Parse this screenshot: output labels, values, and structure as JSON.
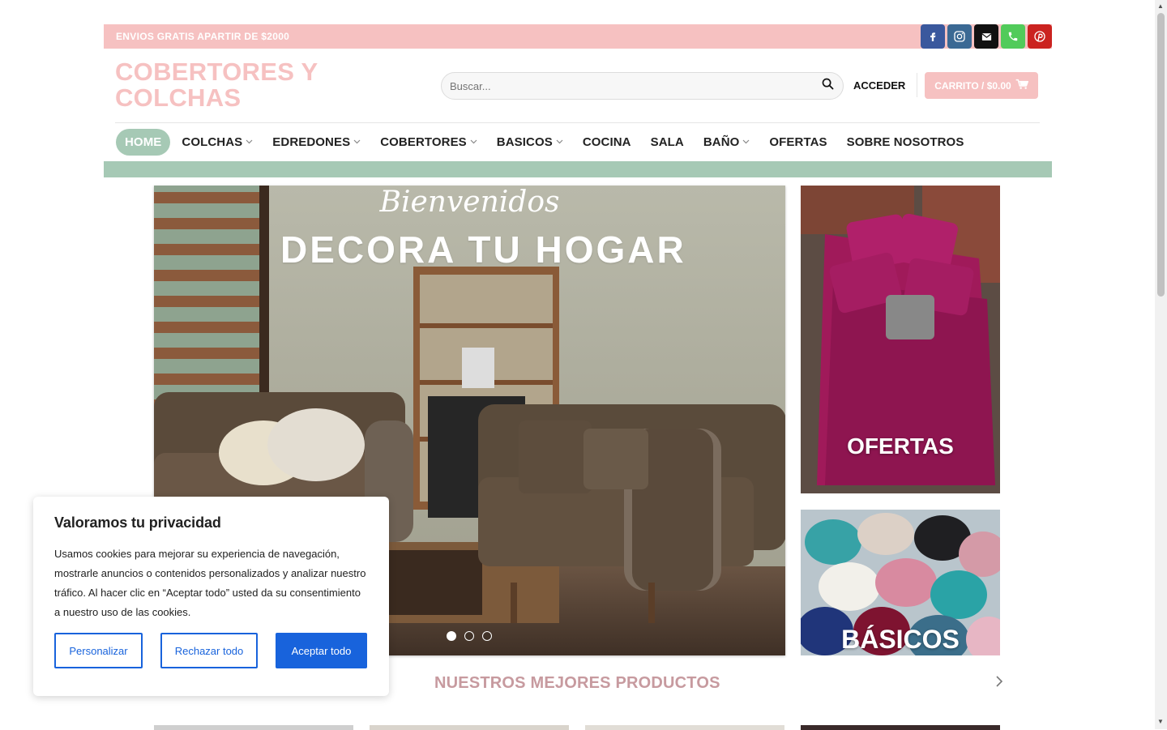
{
  "topbar": {
    "promo": "ENVIOS GRATIS APARTIR DE $2000",
    "social": [
      {
        "name": "facebook-icon",
        "color": "#3a589d"
      },
      {
        "name": "instagram-icon",
        "color": "#3b6994"
      },
      {
        "name": "email-icon",
        "color": "#111111"
      },
      {
        "name": "phone-icon",
        "color": "#51cb5a"
      },
      {
        "name": "pinterest-icon",
        "color": "#cb2320"
      }
    ]
  },
  "header": {
    "logo_line1": "COBERTORES Y",
    "logo_line2": "COLCHAS",
    "search_placeholder": "Buscar...",
    "login": "ACCEDER",
    "cart": "CARRITO / $0.00"
  },
  "nav": {
    "items": [
      {
        "label": "HOME",
        "dropdown": false
      },
      {
        "label": "COLCHAS",
        "dropdown": true
      },
      {
        "label": "EDREDONES",
        "dropdown": true
      },
      {
        "label": "COBERTORES",
        "dropdown": true
      },
      {
        "label": "BASICOS",
        "dropdown": true
      },
      {
        "label": "COCINA",
        "dropdown": false
      },
      {
        "label": "SALA",
        "dropdown": false
      },
      {
        "label": "BAÑO",
        "dropdown": true
      },
      {
        "label": "OFERTAS",
        "dropdown": false
      },
      {
        "label": "SOBRE NOSOTROS",
        "dropdown": false
      }
    ]
  },
  "hero": {
    "welcome": "Bienvenidos",
    "headline": "DECORA TU HOGAR",
    "slides_count": 3,
    "active_slide": 1
  },
  "banners": {
    "ofertas": "OFERTAS",
    "basicos": "BÁSICOS"
  },
  "section": {
    "title": "NUESTROS MEJORES PRODUCTOS"
  },
  "cookie": {
    "title": "Valoramos tu privacidad",
    "body": "Usamos cookies para mejorar su experiencia de navegación, mostrarle anuncios o contenidos personalizados y analizar nuestro tráfico. Al hacer clic en “Aceptar todo” usted da su consentimiento a nuestro uso de las cookies.",
    "customize": "Personalizar",
    "reject": "Rechazar todo",
    "accept": "Aceptar todo"
  },
  "colors": {
    "brand_pink": "#f6c1c1",
    "brand_green": "#a6c9b5",
    "title_pink": "#c79a9f",
    "cookie_blue": "#1863dc"
  }
}
